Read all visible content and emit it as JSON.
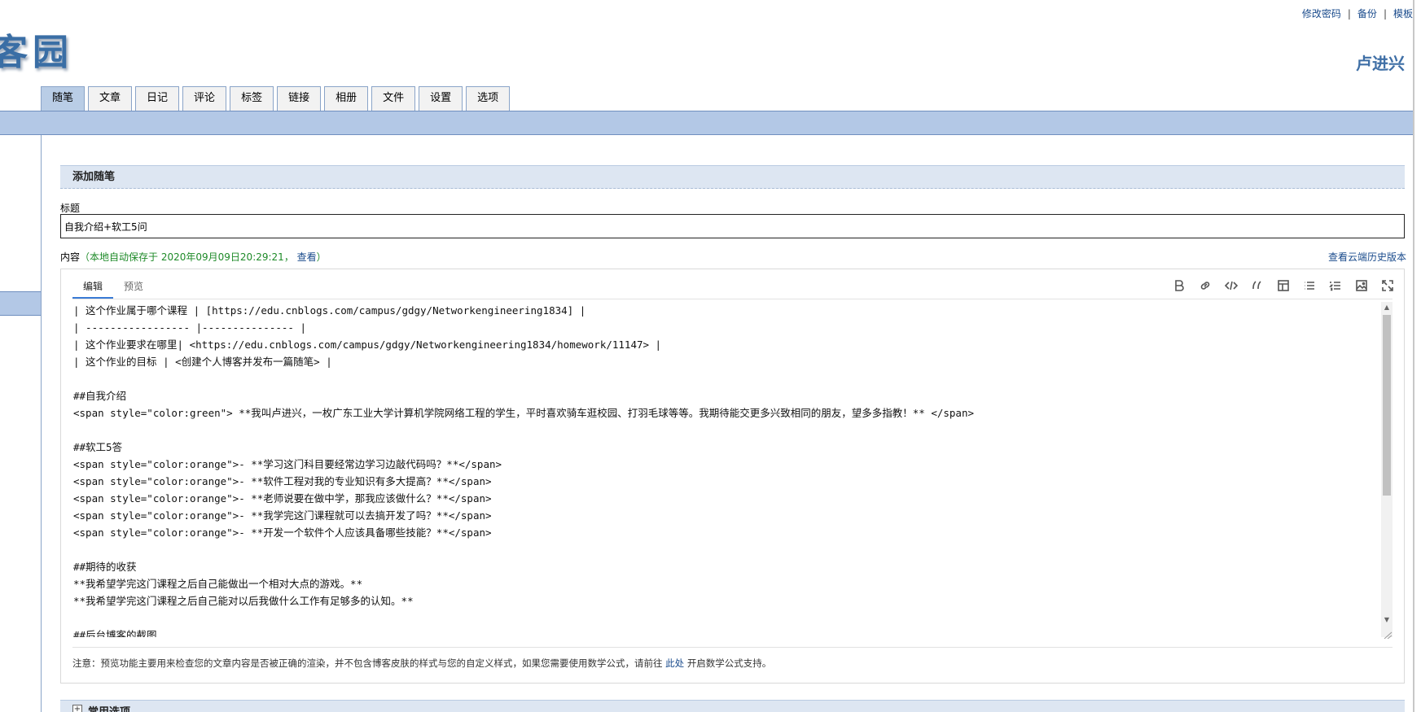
{
  "brand": {
    "logo_text": "客园"
  },
  "top_links": [
    "修改密码",
    "备份",
    "模板"
  ],
  "user": {
    "name": "卢进兴"
  },
  "nav_tabs": [
    {
      "label": "随笔",
      "active": true
    },
    {
      "label": "文章"
    },
    {
      "label": "日记"
    },
    {
      "label": "评论"
    },
    {
      "label": "标签"
    },
    {
      "label": "链接"
    },
    {
      "label": "相册"
    },
    {
      "label": "文件"
    },
    {
      "label": "设置"
    },
    {
      "label": "选项"
    }
  ],
  "form": {
    "section_title": "添加随笔",
    "title_label": "标题",
    "title_value": "自我介绍+软工5问",
    "content_label": "内容",
    "autosave_open": "（",
    "autosave_text": "本地自动保存于 2020年09月09日20:29:21，",
    "autosave_view": "查看",
    "autosave_close": "）",
    "history_link": "查看云端历史版本"
  },
  "editor": {
    "tabs": [
      {
        "label": "编辑",
        "active": true
      },
      {
        "label": "预览"
      }
    ],
    "toolbar": [
      {
        "name": "bold-icon",
        "title": "B"
      },
      {
        "name": "link-icon"
      },
      {
        "name": "code-icon"
      },
      {
        "name": "quote-icon"
      },
      {
        "name": "table-icon"
      },
      {
        "name": "unordered-list-icon"
      },
      {
        "name": "ordered-list-icon"
      },
      {
        "name": "image-icon"
      },
      {
        "name": "fullscreen-icon"
      }
    ],
    "lines": [
      "| 这个作业属于哪个课程 | [https://edu.cnblogs.com/campus/gdgy/Networkengineering1834] |",
      "| ----------------- |--------------- |",
      "| 这个作业要求在哪里| <https://edu.cnblogs.com/campus/gdgy/Networkengineering1834/homework/11147> |",
      "| 这个作业的目标 | <创建个人博客并发布一篇随笔> |",
      "",
      "##自我介绍",
      "<span style=\"color:green\"> **我叫卢进兴，一枚广东工业大学计算机学院网络工程的学生，平时喜欢骑车逛校园、打羽毛球等等。我期待能交更多兴致相同的朋友，望多多指教！** </span>",
      "",
      "##软工5答",
      "<span style=\"color:orange\">- **学习这门科目要经常边学习边敲代码吗？**</span>",
      "<span style=\"color:orange\">- **软件工程对我的专业知识有多大提高？**</span>",
      "<span style=\"color:orange\">- **老师说要在做中学，那我应该做什么？**</span>",
      "<span style=\"color:orange\">- **我学完这门课程就可以去搞开发了吗？**</span>",
      "<span style=\"color:orange\">- **开发一个软件个人应该具备哪些技能？**</span>",
      "",
      "##期待的收获",
      "**我希望学完这门课程之后自己能做出一个相对大点的游戏。**",
      "**我希望学完这门课程之后自己能对以后我做什么工作有足够多的认知。**",
      "",
      "##后台博客的截图"
    ],
    "note_text": "注意：预览功能主要用来检查您的文章内容是否被正确的渲染，并不包含博客皮肤的样式与您的自定义样式，如果您需要使用数学公式，请前往",
    "note_link": "此处",
    "note_suffix": "开启数学公式支持。"
  },
  "options_section": {
    "label": "常用选项"
  }
}
